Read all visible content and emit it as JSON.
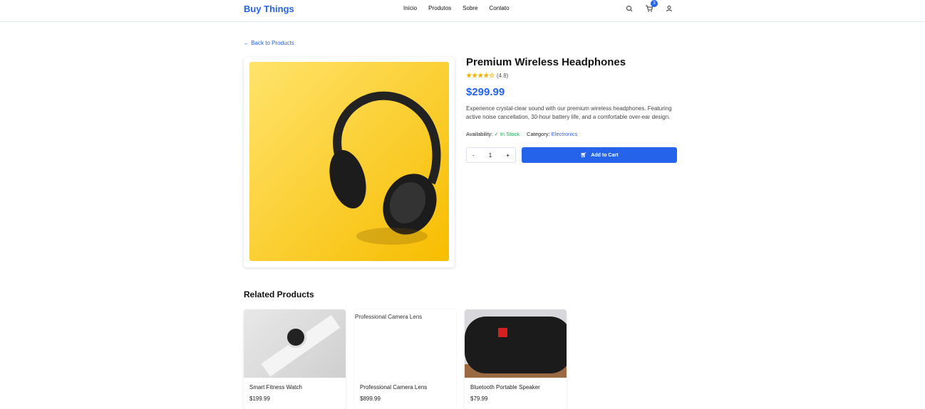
{
  "nav": {
    "logo": "Buy Things",
    "links": [
      "Início",
      "Produtos",
      "Sobre",
      "Contato"
    ],
    "cart_count": "3",
    "icons": [
      "search-icon",
      "cart-icon",
      "user-icon"
    ]
  },
  "back_link": "← Back to Products",
  "product": {
    "title": "Premium Wireless Headphones",
    "stars": "★★★★☆",
    "rating": "(4.8)",
    "rating_value": 4.8,
    "price": "$299.99",
    "description": "Experience crystal-clear sound with our premium wireless headphones. Featuring active noise cancellation, 30-hour battery life, and a comfortable over-ear design.",
    "availability_label": "Availability:",
    "availability": "✓ In Stock",
    "category_label": "Category:",
    "category": "Electronics",
    "qty_minus": "-",
    "qty": "1",
    "qty_plus": "+",
    "add_to_cart": "Add to Cart"
  },
  "related": {
    "title": "Related Products",
    "items": [
      {
        "name": "Smart Fitness Watch",
        "price": "$199.99"
      },
      {
        "name": "Professional Camera Lens",
        "price": "$899.99",
        "alt": "Professional Camera Lens"
      },
      {
        "name": "Bluetooth Portable Speaker",
        "price": "$79.99"
      }
    ]
  },
  "colors": {
    "accent": "#2563eb",
    "success": "#16a34a",
    "star": "#f5b301"
  }
}
